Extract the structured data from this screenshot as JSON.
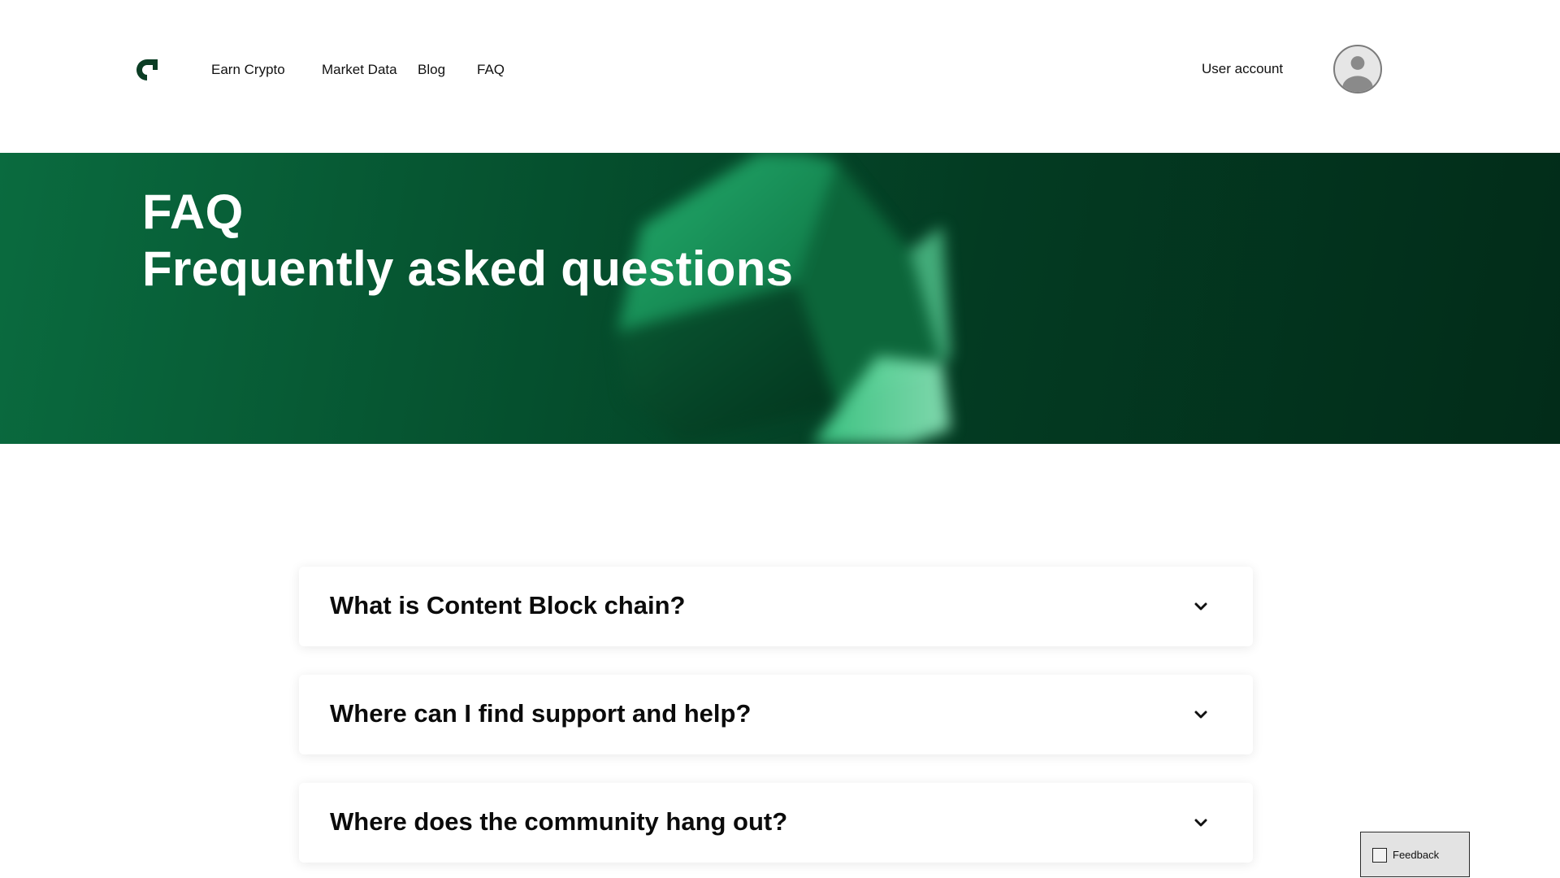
{
  "header": {
    "logo_icon": "brand-logo-icon",
    "nav": [
      {
        "label": "Earn Crypto"
      },
      {
        "label": "Market Data"
      },
      {
        "label": "Blog"
      },
      {
        "label": "FAQ"
      }
    ],
    "user_account_label": "User account",
    "avatar_icon": "user-avatar-icon"
  },
  "hero": {
    "title": "FAQ",
    "subtitle": "Frequently asked questions",
    "background_color": "#05502e"
  },
  "faq": {
    "items": [
      {
        "question": "What is Content Block chain?",
        "icon": "chevron-down-icon"
      },
      {
        "question": "Where can I find support and help?",
        "icon": "chevron-down-icon"
      },
      {
        "question": "Where does the community hang out?",
        "icon": "chevron-down-icon"
      }
    ]
  },
  "feedback": {
    "label": "Feedback",
    "icon": "checkbox-icon"
  },
  "colors": {
    "brand_dark": "#0b3d24",
    "hero_green": "#0a6b3f"
  }
}
